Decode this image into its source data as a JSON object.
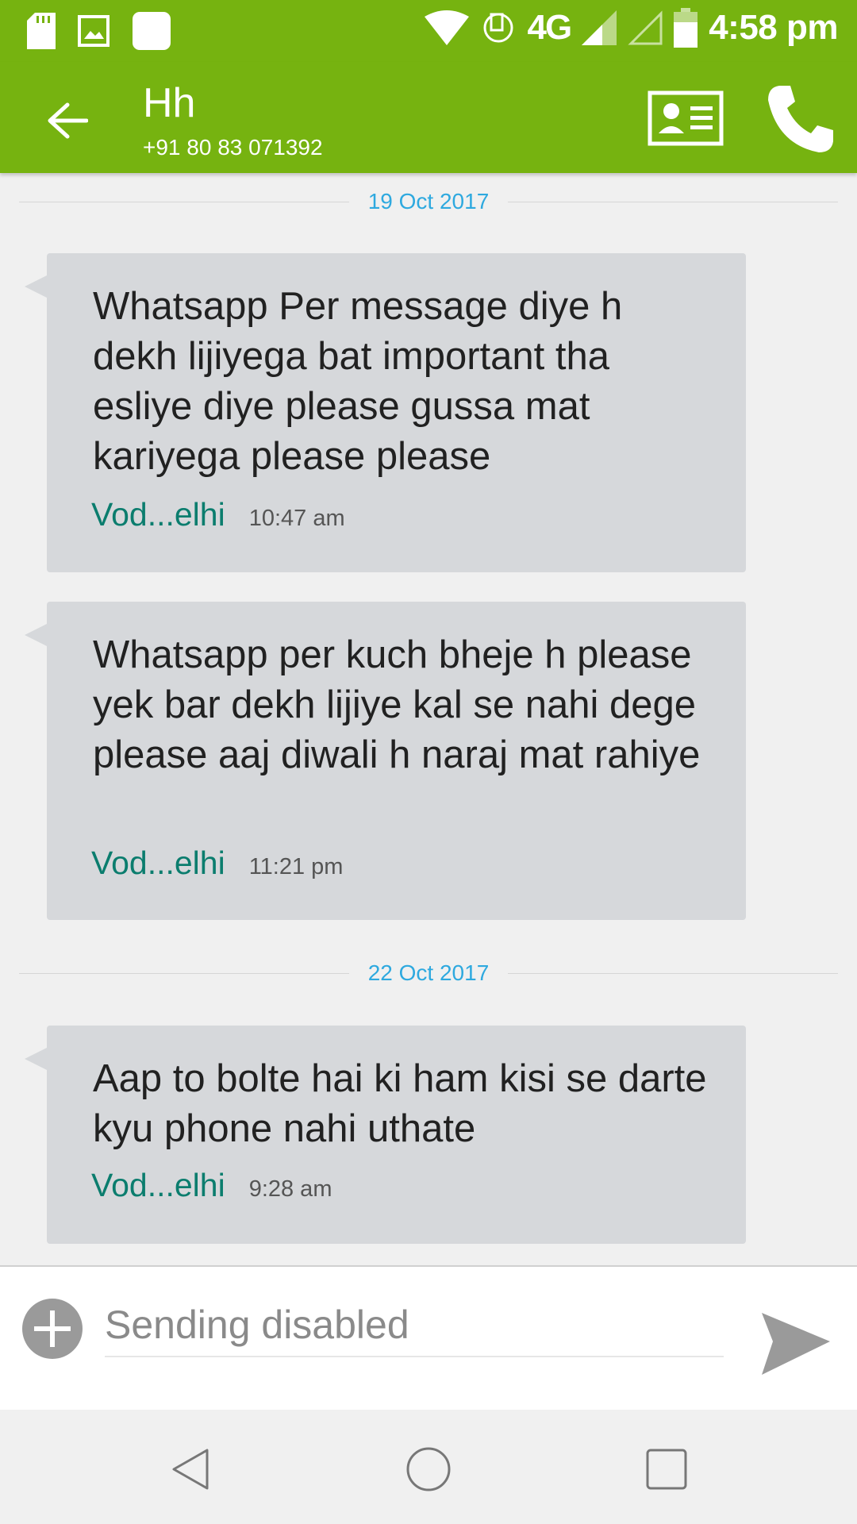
{
  "status_bar": {
    "network": "4G",
    "time": "4:58 pm",
    "bar_color": "#76b310"
  },
  "app_bar": {
    "title": "Hh",
    "subtitle": "+91 80 83 071392",
    "icons": [
      "back-arrow-icon",
      "contact-card-icon",
      "phone-icon"
    ]
  },
  "conversation": {
    "groups": [
      {
        "date": "19 Oct 2017",
        "messages": [
          {
            "text": "Whatsapp Per message diye h dekh lijiyega bat important tha esliye diye please gussa mat kariyega please please",
            "sim": "Vod...elhi",
            "time": "10:47 am"
          },
          {
            "text": "Whatsapp per kuch bheje h please yek bar dekh lijiye kal se nahi dege please aaj diwali h naraj mat rahiye",
            "sim": "Vod...elhi",
            "time": "11:21 pm"
          }
        ]
      },
      {
        "date": "22 Oct 2017",
        "messages": [
          {
            "text": "Aap to bolte hai ki ham kisi se darte kyu phone nahi uthate",
            "sim": "Vod...elhi",
            "time": "9:28 am"
          }
        ]
      }
    ]
  },
  "composer": {
    "placeholder": "Sending disabled"
  },
  "colors": {
    "accent": "#76b310",
    "date_text": "#2ea9df",
    "sim_text": "#0b7d6e",
    "bubble": "#d6d8db"
  }
}
